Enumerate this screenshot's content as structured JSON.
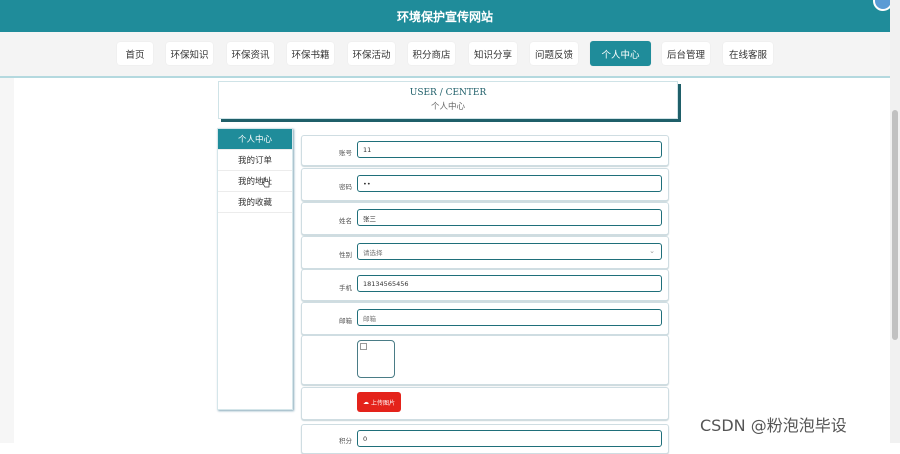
{
  "site": {
    "title": "环境保护宣传网站"
  },
  "nav": {
    "items": [
      {
        "label": "首页"
      },
      {
        "label": "环保知识"
      },
      {
        "label": "环保资讯"
      },
      {
        "label": "环保书籍"
      },
      {
        "label": "环保活动"
      },
      {
        "label": "积分商店"
      },
      {
        "label": "知识分享"
      },
      {
        "label": "问题反馈"
      },
      {
        "label": "个人中心"
      },
      {
        "label": "后台管理"
      },
      {
        "label": "在线客服"
      }
    ],
    "active": "个人中心"
  },
  "header": {
    "en": "USER / CENTER",
    "cn": "个人中心"
  },
  "sidebar": {
    "items": [
      {
        "label": "个人中心"
      },
      {
        "label": "我的订单"
      },
      {
        "label": "我的地址"
      },
      {
        "label": "我的收藏"
      }
    ]
  },
  "form": {
    "account": {
      "label": "账号",
      "value": "11"
    },
    "password": {
      "label": "密码",
      "value": "••"
    },
    "name": {
      "label": "姓名",
      "value": "张三"
    },
    "gender": {
      "label": "性别",
      "placeholder": "请选择"
    },
    "phone": {
      "label": "手机",
      "value": "18134565456"
    },
    "email": {
      "label": "邮箱",
      "value": "邮箱"
    },
    "upload": {
      "label": "上传图片"
    },
    "points": {
      "label": "积分",
      "value": "0"
    }
  },
  "watermark": "CSDN @粉泡泡毕设",
  "colors": {
    "primary": "#1f8c9a",
    "upload": "#e4231b"
  }
}
